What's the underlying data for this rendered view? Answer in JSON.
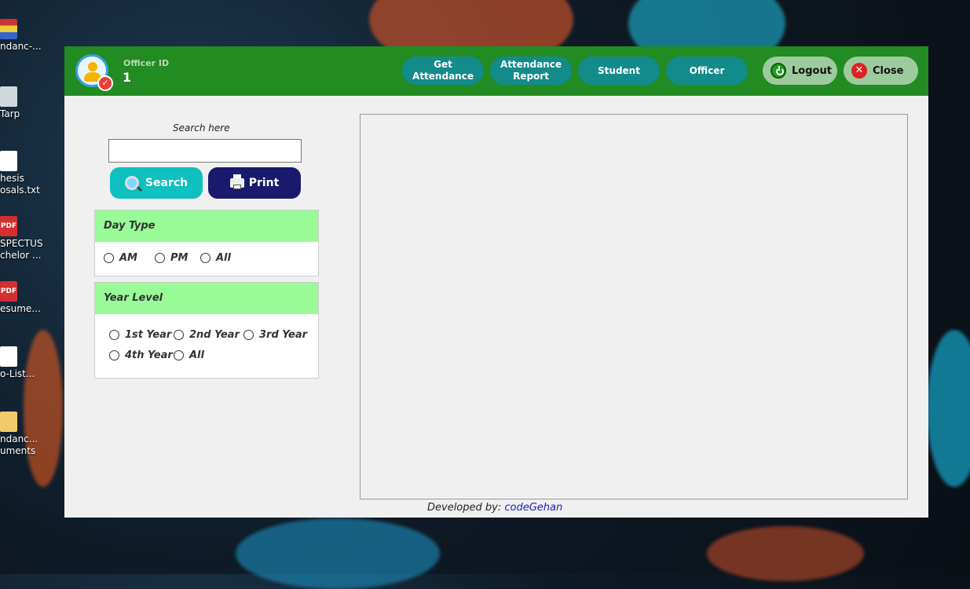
{
  "desktop": {
    "icons": [
      {
        "label": "ndanc-...",
        "icon": "archive-icon"
      },
      {
        "label": "Tarp",
        "icon": "file-icon"
      },
      {
        "label": "hesis\nosals.txt",
        "icon": "text-file-icon"
      },
      {
        "label": "SPECTUS\nchelor ...",
        "icon": "pdf-icon"
      },
      {
        "label": "esume...",
        "icon": "pdf-icon"
      },
      {
        "label": "o-List...",
        "icon": "text-file-icon"
      },
      {
        "label": "ndanc...\numents",
        "icon": "folder-icon"
      }
    ],
    "pdf_badge": "PDF"
  },
  "header": {
    "officer_label": "Officer ID",
    "officer_value": "1",
    "nav": {
      "get_attendance": "Get\nAttendance",
      "attendance_report": "Attendance\nReport",
      "student": "Student",
      "officer": "Officer"
    },
    "logout": "Logout",
    "close": "Close"
  },
  "sidebar": {
    "search_label": "Search here",
    "search_value": "",
    "search_button": "Search",
    "print_button": "Print",
    "day_type": {
      "title": "Day Type",
      "options": [
        "AM",
        "PM",
        "All"
      ]
    },
    "year_level": {
      "title": "Year Level",
      "options": [
        "1st Year",
        "2nd Year",
        "3rd Year",
        "4th Year",
        "All"
      ]
    }
  },
  "footer": {
    "developed_by": "Developed by:",
    "developer": "codeGehan"
  },
  "colors": {
    "header_green": "#228b22",
    "nav_teal": "#138b8b",
    "panel_head_green": "#98fb98",
    "search_btn": "#0ec0c0",
    "print_btn": "#191a6e"
  }
}
